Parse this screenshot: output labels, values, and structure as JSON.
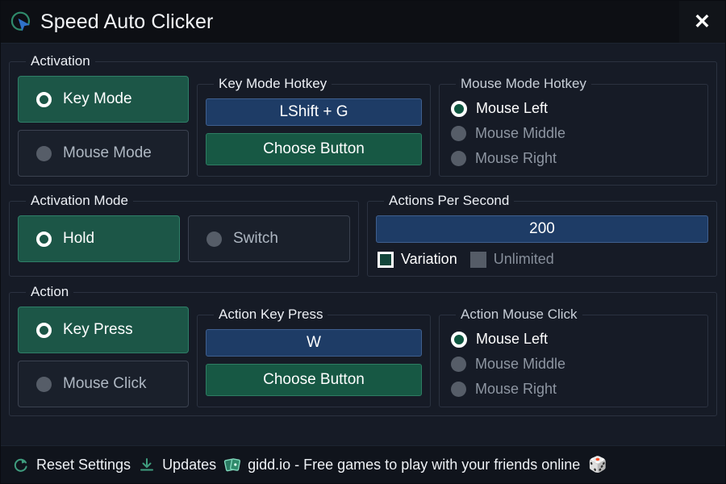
{
  "window": {
    "title": "Speed Auto Clicker",
    "logo_icon": "cursor-arc-logo-icon",
    "close_label": "✕"
  },
  "theme": {
    "background": "#161b26",
    "titlebar": "#0d0f14",
    "accent_green": "#1c5647",
    "accent_green_border": "#2f7f68",
    "accent_blue": "#1e3c66",
    "accent_blue_border": "#3f5f8e",
    "text_primary": "#ffffff",
    "text_muted": "#8e96a2",
    "panel_border": "#2b3240",
    "status_icon_green": "#3f9c7e"
  },
  "activation": {
    "legend": "Activation",
    "modes": [
      {
        "label": "Key Mode",
        "selected": true
      },
      {
        "label": "Mouse Mode",
        "selected": false
      }
    ],
    "key_mode_hotkey": {
      "legend": "Key Mode Hotkey",
      "value": "LShift + G",
      "choose_label": "Choose Button"
    },
    "mouse_mode_hotkey": {
      "legend": "Mouse Mode Hotkey",
      "options": [
        {
          "label": "Mouse Left",
          "selected": true
        },
        {
          "label": "Mouse Middle",
          "selected": false
        },
        {
          "label": "Mouse Right",
          "selected": false
        }
      ]
    }
  },
  "activation_mode": {
    "legend": "Activation Mode",
    "options": [
      {
        "label": "Hold",
        "selected": true
      },
      {
        "label": "Switch",
        "selected": false
      }
    ]
  },
  "actions_per_second": {
    "legend": "Actions Per Second",
    "value": "200",
    "checkboxes": [
      {
        "label": "Variation",
        "checked": false,
        "enabled": true
      },
      {
        "label": "Unlimited",
        "checked": false,
        "enabled": false
      }
    ]
  },
  "action": {
    "legend": "Action",
    "modes": [
      {
        "label": "Key Press",
        "selected": true
      },
      {
        "label": "Mouse Click",
        "selected": false
      }
    ],
    "action_key_press": {
      "legend": "Action Key Press",
      "value": "W",
      "choose_label": "Choose Button"
    },
    "action_mouse_click": {
      "legend": "Action Mouse Click",
      "options": [
        {
          "label": "Mouse Left",
          "selected": true
        },
        {
          "label": "Mouse Middle",
          "selected": false
        },
        {
          "label": "Mouse Right",
          "selected": false
        }
      ]
    }
  },
  "statusbar": {
    "reset": {
      "icon": "refresh-icon",
      "label": "Reset Settings"
    },
    "updates": {
      "icon": "download-icon",
      "label": "Updates"
    },
    "promo": {
      "icon": "cards-icon",
      "label": "gidd.io - Free games to play with your friends online",
      "trailing_icon": "🎲"
    }
  }
}
